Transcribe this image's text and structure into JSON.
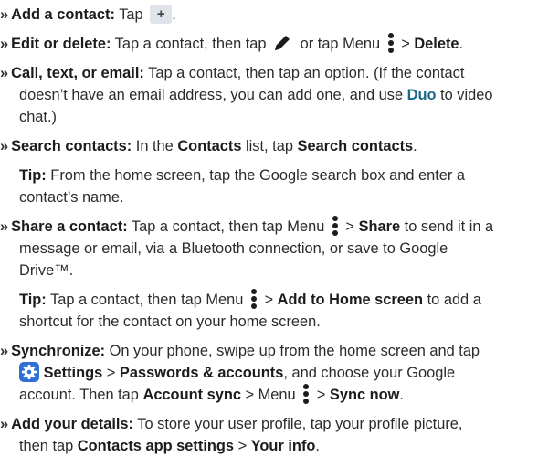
{
  "marker": "»",
  "menu_icon": "more-vert-icon",
  "items": {
    "add": {
      "label": "Add a contact:",
      "text1": " Tap ",
      "text2": "."
    },
    "edit": {
      "label": "Edit or delete:",
      "text1": " Tap a contact, then tap ",
      "text2": " or tap Menu ",
      "sep": " > ",
      "action": "Delete",
      "end": "."
    },
    "call": {
      "label": "Call, text, or email:",
      "line1": " Tap a contact, then tap an option. (If the contact",
      "line2a": "doesn’t have an email address, you can add one, and use ",
      "link": "Duo",
      "line2b": " to video",
      "line3": "chat.)"
    },
    "search": {
      "label": "Search contacts:",
      "text1": " In the ",
      "bold1": "Contacts",
      "text2": " list, tap ",
      "bold2": "Search contacts",
      "end": "."
    },
    "tip1": {
      "label": "Tip:",
      "line1": " From the home screen, tap the Google search box and enter a",
      "line2": "contact’s name."
    },
    "share": {
      "label": "Share a contact:",
      "text1": " Tap a contact, then tap Menu ",
      "sep": " > ",
      "bold1": "Share",
      "text2": " to send it in a",
      "line2": "message or email, via a Bluetooth connection, or save to Google",
      "line3": "Drive™."
    },
    "tip2": {
      "label": "Tip:",
      "text1": " Tap a contact, then tap Menu ",
      "sep": " > ",
      "bold1": "Add to Home screen",
      "text2": " to add a",
      "line2": "shortcut for the contact on your home screen."
    },
    "sync": {
      "label": "Synchronize:",
      "line1": " On your phone, swipe up from the home screen and tap",
      "settings": "Settings",
      "sep": " > ",
      "bold1": "Passwords & accounts",
      "text2": ", and choose your Google",
      "text3": "account. Then tap ",
      "bold2": "Account sync",
      "text4": " > Menu ",
      "sep2": " > ",
      "bold3": "Sync now",
      "end": "."
    },
    "details": {
      "label": "Add your details:",
      "line1": " To store your user profile, tap your profile picture,",
      "text2": "then tap ",
      "bold1": "Contacts app settings",
      "sep": " > ",
      "bold2": "Your info",
      "end": "."
    }
  }
}
